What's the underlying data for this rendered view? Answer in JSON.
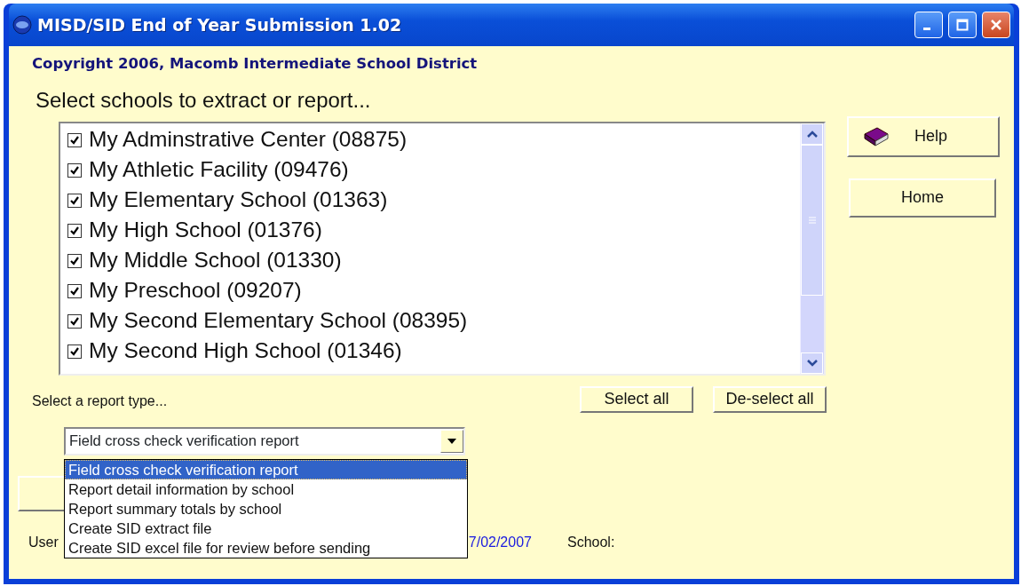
{
  "window": {
    "title": "MISD/SID End of Year Submission 1.02"
  },
  "copyright": "Copyright 2006, Macomb Intermediate School District",
  "schools_heading": "Select schools to extract or report...",
  "schools": [
    {
      "label": "My Adminstrative Center (08875)",
      "checked": true
    },
    {
      "label": "My Athletic Facility (09476)",
      "checked": true
    },
    {
      "label": "My Elementary School (01363)",
      "checked": true
    },
    {
      "label": "My High School (01376)",
      "checked": true
    },
    {
      "label": "My Middle School (01330)",
      "checked": true
    },
    {
      "label": "My Preschool (09207)",
      "checked": true
    },
    {
      "label": "My Second Elementary School (08395)",
      "checked": true
    },
    {
      "label": "My Second High School (01346)",
      "checked": true
    }
  ],
  "buttons": {
    "help": "Help",
    "home": "Home",
    "select_all": "Select all",
    "deselect_all": "De-select all"
  },
  "report_type": {
    "label": "Select a report type...",
    "value": "Field cross check verification report",
    "expanded": true,
    "options": [
      {
        "label": "Field cross check verification report",
        "selected": true
      },
      {
        "label": "Report detail information by school",
        "selected": false
      },
      {
        "label": "Report summary totals by school",
        "selected": false
      },
      {
        "label": "Create SID extract file",
        "selected": false
      },
      {
        "label": "Create SID excel file for review before sending",
        "selected": false
      }
    ]
  },
  "status": {
    "user_label": "User",
    "date": "7/02/2007",
    "school_label": "School:"
  }
}
